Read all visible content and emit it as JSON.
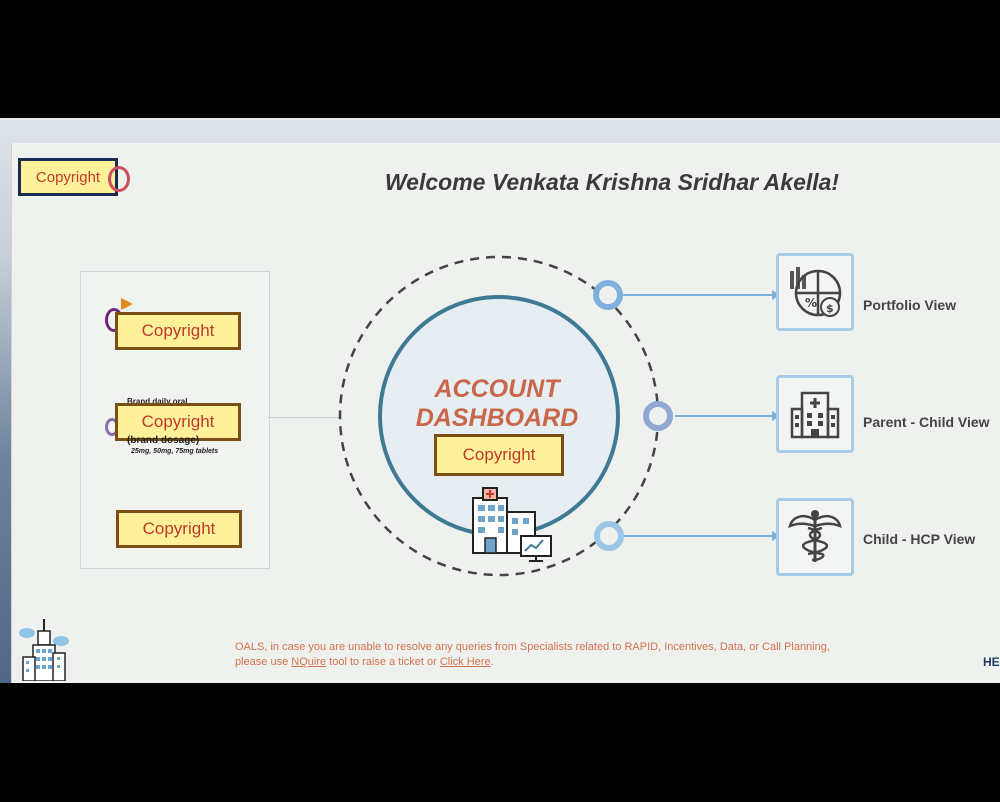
{
  "branding": {
    "logo_label": "Copyright"
  },
  "header": {
    "welcome": "Welcome Venkata Krishna Sridhar Akella!"
  },
  "left_panel": {
    "items": [
      {
        "label": "Copyright"
      },
      {
        "label": "Copyright",
        "dose_top": "Brand daily oral",
        "dose_name": "(brand dosage)",
        "dose_strengths": "25mg, 50mg, 75mg tablets"
      },
      {
        "label": "Copyright"
      }
    ]
  },
  "dashboard": {
    "title_line1": "ACCOUNT",
    "title_line2": "DASHBOARD",
    "badge_label": "Copyright"
  },
  "views": [
    {
      "label": "Portfolio View",
      "icon": "portfolio-chart-icon"
    },
    {
      "label": "Parent - Child View",
      "icon": "hospital-building-icon"
    },
    {
      "label": "Child - HCP View",
      "icon": "caduceus-icon"
    }
  ],
  "footer": {
    "notice_part1": "OALS, in case you are unable to resolve any queries from Specialists related to RAPID, Incentives, Data, or Call Planning, please use ",
    "nquire_link": "NQuire",
    "notice_part2": " tool to raise a ticket or ",
    "click_here_link": "Click Here",
    "notice_part3": ".",
    "he_label": "HE"
  },
  "colors": {
    "accent": "#c8674a",
    "ring": "#3f7a95",
    "view_border": "#a9cbe6",
    "badge_fill": "#fff19a"
  }
}
